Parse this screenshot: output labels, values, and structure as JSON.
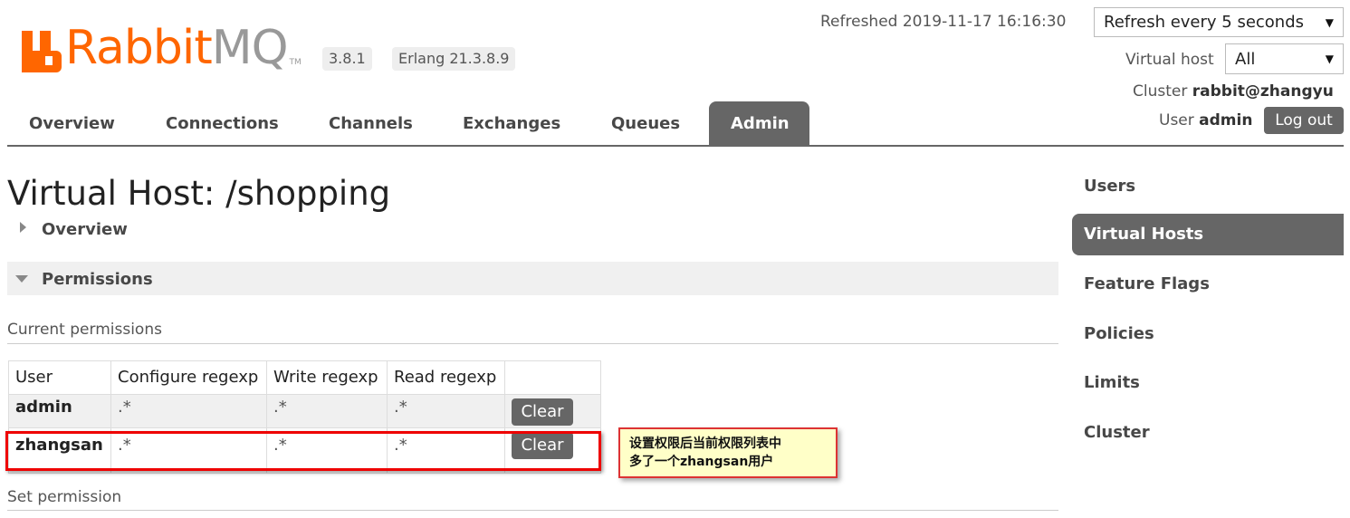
{
  "header": {
    "brand_primary": "Rabbit",
    "brand_secondary": "MQ",
    "brand_tm": "TM",
    "version": "3.8.1",
    "erlang": "Erlang 21.3.8.9",
    "refreshed": "Refreshed 2019-11-17 16:16:30",
    "refresh_select": "Refresh every 5 seconds",
    "vhost_label": "Virtual host",
    "vhost_select": "All",
    "cluster_label": "Cluster",
    "cluster_name": "rabbit@zhangyu",
    "user_label": "User",
    "user_name": "admin",
    "logout_label": "Log out"
  },
  "nav": {
    "tabs": [
      {
        "label": "Overview"
      },
      {
        "label": "Connections"
      },
      {
        "label": "Channels"
      },
      {
        "label": "Exchanges"
      },
      {
        "label": "Queues"
      },
      {
        "label": "Admin"
      }
    ],
    "active": "Admin"
  },
  "main": {
    "title": "Virtual Host: /shopping",
    "overview_section": "Overview",
    "permissions_section": "Permissions",
    "current_permissions": "Current permissions",
    "set_permission": "Set permission",
    "table": {
      "headers": [
        "User",
        "Configure regexp",
        "Write regexp",
        "Read regexp",
        ""
      ],
      "rows": [
        {
          "user": "admin",
          "configure": ".*",
          "write": ".*",
          "read": ".*",
          "action": "Clear"
        },
        {
          "user": "zhangsan",
          "configure": ".*",
          "write": ".*",
          "read": ".*",
          "action": "Clear"
        }
      ]
    },
    "annotation": {
      "line1": "设置权限后当前权限列表中",
      "line2": "多了一个zhangsan用户"
    }
  },
  "sidebar": {
    "items": [
      {
        "label": "Users"
      },
      {
        "label": "Virtual Hosts"
      },
      {
        "label": "Feature Flags"
      },
      {
        "label": "Policies"
      },
      {
        "label": "Limits"
      },
      {
        "label": "Cluster"
      }
    ],
    "active": "Virtual Hosts"
  },
  "colors": {
    "brand_orange": "#ff6600",
    "brand_gray": "#999999",
    "tab_active": "#666666",
    "highlight_border": "#ee0000",
    "callout_bg": "#ffffc8"
  }
}
